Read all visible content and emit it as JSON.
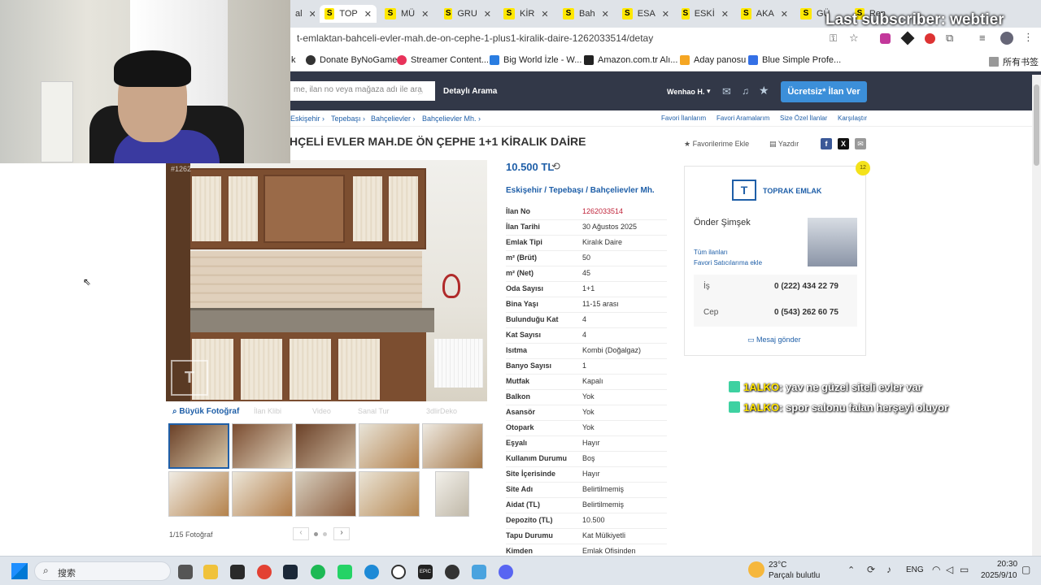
{
  "browser": {
    "tabs": [
      {
        "label": "al"
      },
      {
        "label": "TOP",
        "active": true
      },
      {
        "label": "MÜ"
      },
      {
        "label": "GRU"
      },
      {
        "label": "KİR"
      },
      {
        "label": "Bah"
      },
      {
        "label": "ESA"
      },
      {
        "label": "ESKİ"
      },
      {
        "label": "AKA"
      },
      {
        "label": "GÜ"
      },
      {
        "label": "Ren"
      }
    ],
    "url": "t-emlaktan-bahceli-evler-mah.de-on-cephe-1-plus1-kiralik-daire-1262033514/detay",
    "bookmarks": [
      "k",
      "Donate ByNoGame",
      "Streamer Content...",
      "Big World İzle - W...",
      "Amazon.com.tr Alı...",
      "Aday panosu",
      "Blue Simple Profe...",
      "所有书签"
    ]
  },
  "site_header": {
    "search_placeholder": "me, ilan no veya mağaza adı ile ara",
    "detailed_search": "Detaylı Arama",
    "user": "Wenhao H.",
    "post_button": "Ücretsiz* İlan Ver"
  },
  "breadcrumb": [
    "Eskişehir",
    "Tepebaşı",
    "Bahçelievler",
    "Bahçelievler Mh."
  ],
  "top_links": [
    "Favori İlanlarım",
    "Favori Aramalarım",
    "Size Özel İlanlar",
    "Karşılaştır"
  ],
  "listing": {
    "title": "HÇELİ EVLER MAH.DE ÖN ÇEPHE 1+1 KİRALIK DAİRE",
    "favorite": "Favorilerime Ekle",
    "print": "Yazdır",
    "price": "10.500 TL",
    "location": [
      "Eskişehir",
      "Tepebaşı",
      "Bahçelievler Mh."
    ],
    "photo_id": "#1262",
    "photo_options": [
      "Büyük Fotoğraf",
      "İlan Klibi",
      "Video",
      "Sanal Tur",
      "3dlirDeko"
    ],
    "photo_counter": "1/15 Fotoğraf",
    "details": [
      {
        "label": "İlan No",
        "value": "1262033514",
        "highlight": true
      },
      {
        "label": "İlan Tarihi",
        "value": "30 Ağustos 2025"
      },
      {
        "label": "Emlak Tipi",
        "value": "Kiralık Daire"
      },
      {
        "label": "m² (Brüt)",
        "value": "50"
      },
      {
        "label": "m² (Net)",
        "value": "45"
      },
      {
        "label": "Oda Sayısı",
        "value": "1+1"
      },
      {
        "label": "Bina Yaşı",
        "value": "11-15 arası"
      },
      {
        "label": "Bulunduğu Kat",
        "value": "4"
      },
      {
        "label": "Kat Sayısı",
        "value": "4"
      },
      {
        "label": "Isıtma",
        "value": "Kombi (Doğalgaz)"
      },
      {
        "label": "Banyo Sayısı",
        "value": "1"
      },
      {
        "label": "Mutfak",
        "value": "Kapalı"
      },
      {
        "label": "Balkon",
        "value": "Yok"
      },
      {
        "label": "Asansör",
        "value": "Yok"
      },
      {
        "label": "Otopark",
        "value": "Yok"
      },
      {
        "label": "Eşyalı",
        "value": "Hayır"
      },
      {
        "label": "Kullanım Durumu",
        "value": "Boş"
      },
      {
        "label": "Site İçerisinde",
        "value": "Hayır"
      },
      {
        "label": "Site Adı",
        "value": "Belirtilmemiş"
      },
      {
        "label": "Aidat (TL)",
        "value": "Belirtilmemiş"
      },
      {
        "label": "Depozito (TL)",
        "value": "10.500"
      },
      {
        "label": "Tapu Durumu",
        "value": "Kat Mülkiyetli"
      },
      {
        "label": "Kimden",
        "value": "Emlak Ofisinden"
      }
    ]
  },
  "seller": {
    "badge": "12",
    "store": "TOPRAK EMLAK",
    "name": "Önder Şimşek",
    "links": [
      "Tüm ilanları",
      "Favori Satıcılarıma ekle"
    ],
    "phones": [
      {
        "label": "İş",
        "number": "0 (222) 434 22 79"
      },
      {
        "label": "Cep",
        "number": "0 (543) 262 60 75"
      }
    ],
    "message": "Mesaj gönder"
  },
  "stream_overlay": {
    "last_subscriber": "Last subscriber: webtier",
    "chat": [
      {
        "user": "1ALKO",
        "message": ": yav ne güzel siteli evler var"
      },
      {
        "user": "1ALKO",
        "message": ": spor salonu falan herşeyi oluyor"
      }
    ]
  },
  "taskbar": {
    "search": "搜索",
    "weather_temp": "23°C",
    "weather_desc": "Parçalı bulutlu",
    "lang": "ENG",
    "time": "20:30",
    "date": "2025/9/10"
  }
}
